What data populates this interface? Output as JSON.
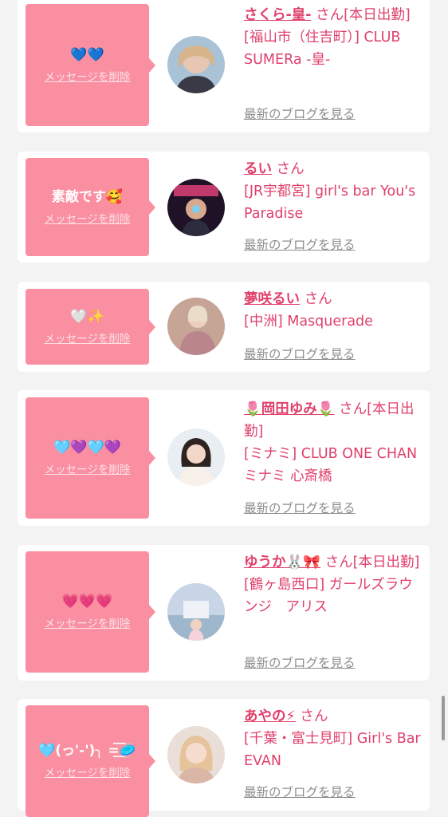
{
  "cards": [
    {
      "message": "💙💙",
      "delete_label": "メッセージを削除",
      "name": "さくら-皇-",
      "san": "さん",
      "badge": "[本日出勤]",
      "shop": "[福山市（住吉町）] CLUB SUMERa -皇-",
      "blog_label": "最新のブログを見る"
    },
    {
      "message": "素敵です🥰",
      "delete_label": "メッセージを削除",
      "name": "るい",
      "san": "さん",
      "badge": "",
      "shop": "[JR宇都宮] girl's bar You's Paradise",
      "blog_label": "最新のブログを見る"
    },
    {
      "message": "🤍✨",
      "delete_label": "メッセージを削除",
      "name": "夢咲るい",
      "san": "さん",
      "badge": "",
      "shop": "[中洲] Masquerade",
      "blog_label": "最新のブログを見る"
    },
    {
      "message": "🩵💜🩵💜",
      "delete_label": "メッセージを削除",
      "name": "🌷岡田ゆみ🌷",
      "san": "さん",
      "badge": "[本日出勤]",
      "shop": "[ミナミ] CLUB ONE CHAN ミナミ 心斎橋",
      "blog_label": "最新のブログを見る"
    },
    {
      "message": "💗💗💗",
      "delete_label": "メッセージを削除",
      "name": "ゆうか🐰🎀",
      "san": "さん",
      "badge": "[本日出勤]",
      "shop": "[鶴ヶ島西口] ガールズラウンジ　アリス",
      "blog_label": "最新のブログを見る"
    },
    {
      "message": "🩵(っ'-')╮ =͟͟͞͞🥏",
      "delete_label": "メッセージを削除",
      "name": "あやの⚡",
      "san": "さん",
      "badge": "",
      "shop": "[千葉・富士見町] Girl's Bar EVAN",
      "blog_label": "最新のブログを見る"
    }
  ],
  "colors": {
    "accent": "#e0406a",
    "bubble": "#f98fa1",
    "background": "#f3f3f3",
    "link_gray": "#8d8d8d"
  }
}
